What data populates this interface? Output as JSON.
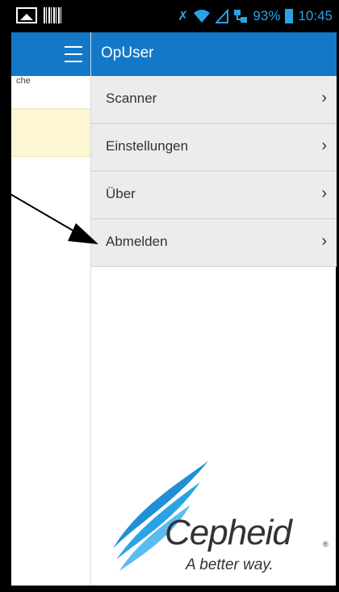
{
  "status_bar": {
    "battery": "93%",
    "time": "10:45"
  },
  "background": {
    "text": "che"
  },
  "drawer": {
    "title": "OpUser",
    "items": [
      {
        "label": "Scanner"
      },
      {
        "label": "Einstellungen"
      },
      {
        "label": "Über"
      },
      {
        "label": "Abmelden"
      }
    ]
  },
  "logo": {
    "name": "Cepheid",
    "tagline": "A better way.",
    "reg": "®"
  },
  "colors": {
    "app_bar": "#1378c8",
    "status_text": "#2aa3e6",
    "menu_bg": "#ececec",
    "highlight": "#fcf6d2"
  }
}
